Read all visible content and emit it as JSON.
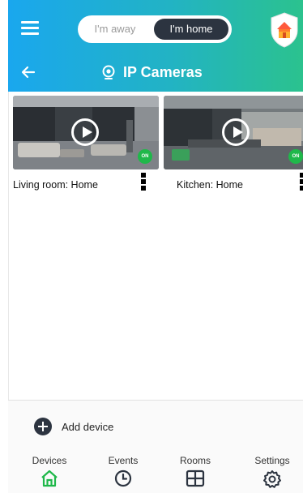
{
  "header": {
    "mode_away": "I'm away",
    "mode_home": "I'm home",
    "title": "IP Cameras",
    "active_mode": "I'm home"
  },
  "cameras": [
    {
      "label": "Living room: Home",
      "status": "ON"
    },
    {
      "label": "Kitchen: Home",
      "status": "ON"
    }
  ],
  "footer": {
    "add_device": "Add device",
    "nav": [
      {
        "label": "Devices",
        "icon": "home-icon",
        "active": true
      },
      {
        "label": "Events",
        "icon": "clock-icon",
        "active": false
      },
      {
        "label": "Rooms",
        "icon": "grid-icon",
        "active": false
      },
      {
        "label": "Settings",
        "icon": "gear-icon",
        "active": false
      }
    ]
  },
  "colors": {
    "header_gradient_start": "#1aa7ee",
    "header_gradient_end": "#2bc28e",
    "dark": "#2c3440",
    "status_on": "#1fb84a",
    "nav_active": "#1fb84a"
  }
}
